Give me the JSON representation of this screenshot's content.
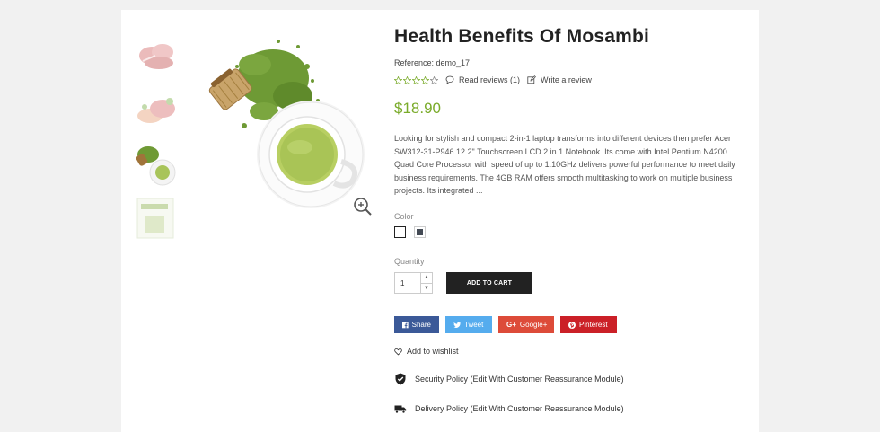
{
  "product": {
    "title": "Health Benefits Of Mosambi",
    "reference": "Reference: demo_17",
    "rating_stars": 0,
    "read_reviews": "Read reviews (1)",
    "write_review": "Write a review",
    "price": "$18.90",
    "description": "Looking for stylish and compact 2-in-1 laptop transforms into different devices then prefer Acer SW312-31-P946 12.2\" Touchscreen LCD 2 in 1 Notebook. Its come with Intel Pentium N4200 Quad Core Processor with speed of up to 1.10GHz delivers powerful performance to meet daily business requirements. The 4GB RAM offers smooth multitasking to work on multiple business projects. Its integrated ..."
  },
  "options": {
    "color_label": "Color",
    "colors": [
      "#ffffff",
      "#434a54"
    ],
    "quantity_label": "Quantity",
    "quantity_value": "1",
    "add_to_cart": "ADD TO CART"
  },
  "social": {
    "share": "Share",
    "tweet": "Tweet",
    "google": "Google+",
    "pinterest": "Pinterest"
  },
  "wishlist": "Add to wishlist",
  "policies": {
    "security": "Security Policy (Edit With Customer Reassurance Module)",
    "delivery": "Delivery Policy (Edit With Customer Reassurance Module)"
  },
  "colors": {
    "price": "#7aab2a",
    "cart_button": "#222222",
    "facebook": "#3b5998",
    "twitter": "#55acee",
    "google": "#dd4b39",
    "pinterest": "#cb2027"
  }
}
